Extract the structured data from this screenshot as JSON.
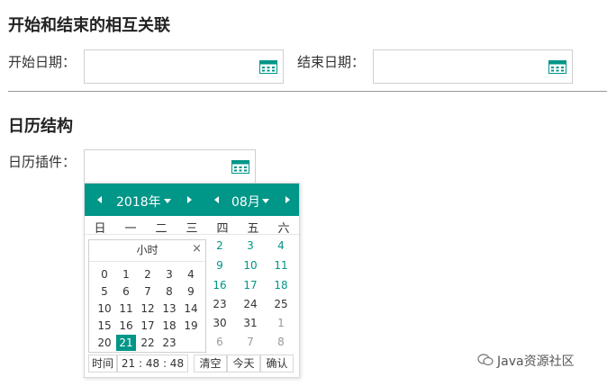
{
  "section1": {
    "title": "开始和结束的相互关联",
    "start_label": "开始日期：",
    "end_label": "结束日期："
  },
  "section2": {
    "title": "日历结构",
    "plugin_label": "日历插件："
  },
  "calendar": {
    "year": "2018年",
    "month": "08月",
    "weekdays": [
      "日",
      "一",
      "二",
      "三",
      "四",
      "五",
      "六"
    ],
    "visible_days": [
      {
        "d": "2",
        "kind": "cur"
      },
      {
        "d": "3",
        "kind": "cur"
      },
      {
        "d": "4",
        "kind": "cur"
      },
      {
        "d": "9",
        "kind": "cur"
      },
      {
        "d": "10",
        "kind": "cur"
      },
      {
        "d": "11",
        "kind": "cur"
      },
      {
        "d": "16",
        "kind": "cur"
      },
      {
        "d": "17",
        "kind": "cur"
      },
      {
        "d": "18",
        "kind": "cur"
      },
      {
        "d": "23",
        "kind": "oth"
      },
      {
        "d": "24",
        "kind": "oth"
      },
      {
        "d": "25",
        "kind": "oth"
      },
      {
        "d": "30",
        "kind": "oth"
      },
      {
        "d": "31",
        "kind": "oth"
      },
      {
        "d": "1",
        "kind": "nxt"
      },
      {
        "d": "6",
        "kind": "nxt"
      },
      {
        "d": "7",
        "kind": "nxt"
      },
      {
        "d": "8",
        "kind": "nxt"
      }
    ],
    "accent": "#009688"
  },
  "hour_panel": {
    "title": "小时",
    "close": "×",
    "hours": [
      "0",
      "1",
      "2",
      "3",
      "4",
      "5",
      "6",
      "7",
      "8",
      "9",
      "10",
      "11",
      "12",
      "13",
      "14",
      "15",
      "16",
      "17",
      "18",
      "19",
      "20",
      "21",
      "22",
      "23"
    ],
    "selected": "21"
  },
  "footer": {
    "time_label": "时间",
    "time_value": "21 : 48 : 48",
    "clear": "清空",
    "today": "今天",
    "confirm": "确认"
  },
  "watermark": "Java资源社区"
}
